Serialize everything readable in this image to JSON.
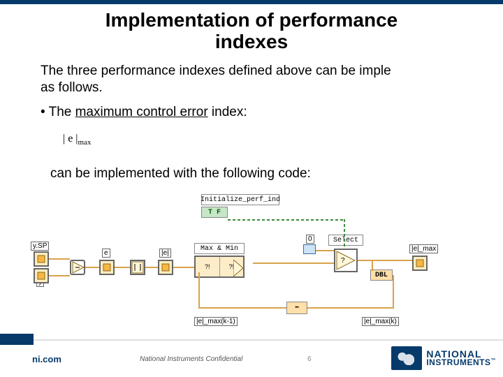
{
  "title_line1": "Implementation of performance",
  "title_line2": "indexes",
  "body_line1": "The three performance indexes defined above can be imple",
  "body_line2": "as follows.",
  "bullet_prefix": "• The ",
  "bullet_underline": "maximum control error",
  "bullet_suffix": " index:",
  "formula_main": "| e |",
  "formula_sub": "max",
  "impl_text": "can be implemented with the following code:",
  "diagram": {
    "ysp": "y.SP",
    "y": "y",
    "e": "e",
    "abs_e": "|e|",
    "init": "Initialize_perf_ind",
    "tf": "T F",
    "maxmin": "Max & Min",
    "maxmin_sub1": "?!",
    "maxmin_sub2": "?!",
    "zero": "0",
    "select": "Select",
    "dbl": "DBL",
    "e_max": "|e|_max",
    "e_max_k1": "|e|_max(k-1)",
    "e_max_k": "|e|_max(k)",
    "shiftreg": "⬅"
  },
  "footer": {
    "confidential": "National Instruments Confidential",
    "page": "6",
    "site": "ni.com",
    "logo_l1": "NATIONAL",
    "logo_l2": "INSTRUMENTS",
    "tm": "™"
  }
}
